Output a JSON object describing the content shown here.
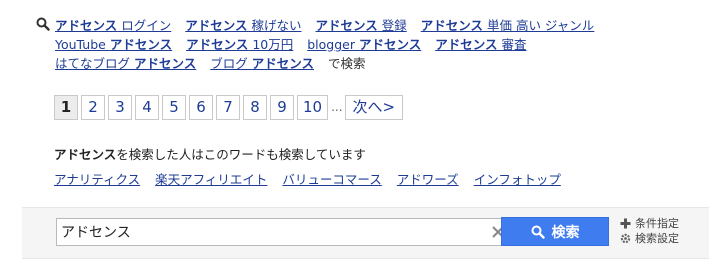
{
  "related": {
    "rows": [
      [
        {
          "bold": "アドセンス",
          "rest": " ログイン"
        },
        {
          "bold": "アドセンス",
          "rest": " 稼げない"
        },
        {
          "bold": "アドセンス",
          "rest": " 登録"
        },
        {
          "bold": "アドセンス",
          "rest": " 単価 高い ジャンル"
        }
      ],
      [
        {
          "pre": "YouTube ",
          "bold": "アドセンス",
          "rest": ""
        },
        {
          "bold": "アドセンス",
          "rest": " 10万円"
        },
        {
          "pre": "blogger ",
          "bold": "アドセンス",
          "rest": ""
        },
        {
          "bold": "アドセンス",
          "rest": " 審査"
        }
      ],
      [
        {
          "pre": "はてなブログ ",
          "bold": "アドセンス",
          "rest": ""
        },
        {
          "pre": "ブログ ",
          "bold": "アドセンス",
          "rest": ""
        }
      ]
    ],
    "tail": "で検索"
  },
  "pager": {
    "current": "1",
    "pages": [
      "2",
      "3",
      "4",
      "5",
      "6",
      "7",
      "8",
      "9",
      "10"
    ],
    "ellipsis": "...",
    "next_label": "次へ>"
  },
  "also": {
    "heading_bold": "アドセンス",
    "heading_rest": "を検索した人はこのワードも検索しています",
    "links": [
      "アナリティクス",
      "楽天アフィリエイト",
      "バリューコマース",
      "アドワーズ",
      "インフォトップ"
    ]
  },
  "search": {
    "value": "アドセンス",
    "button_label": "検索",
    "option_condition": "条件指定",
    "option_settings": "検索設定",
    "button_color": "#3f7cf0"
  }
}
